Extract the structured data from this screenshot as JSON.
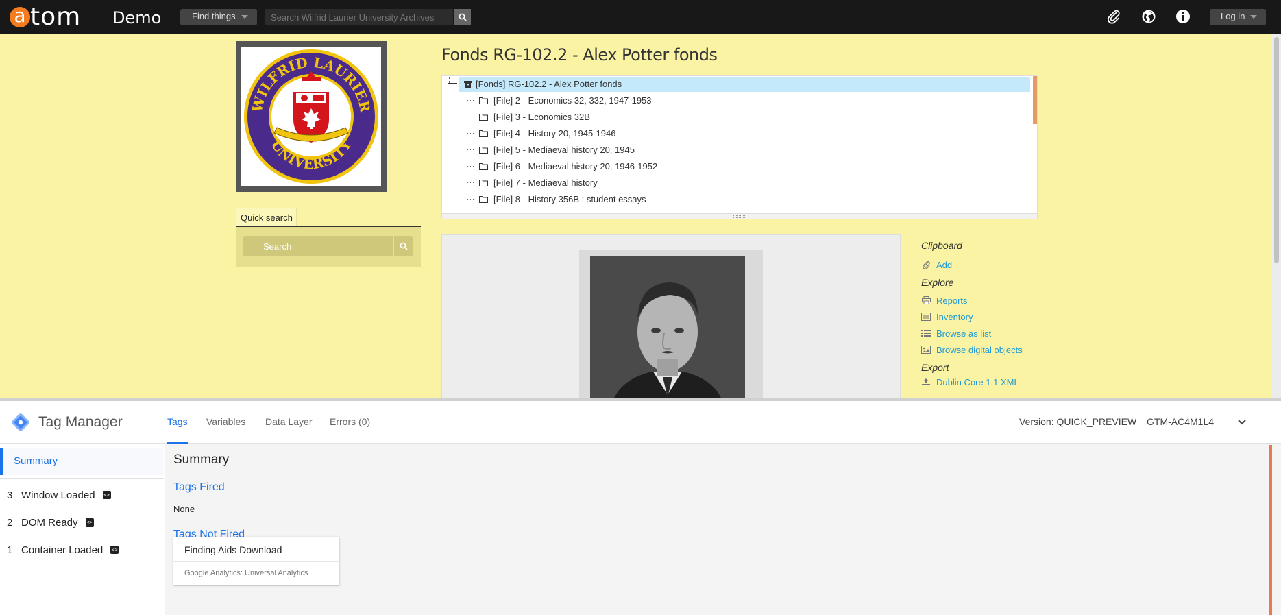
{
  "header": {
    "logo_letter": "a",
    "logo_text": "tom",
    "site_name": "Demo",
    "find_things": "Find things",
    "search_placeholder": "Search Wilfrid Laurier University Archives",
    "login": "Log in",
    "icons": [
      "search-icon",
      "paperclip-icon",
      "globe-icon",
      "info-icon"
    ]
  },
  "sidebar": {
    "quick_search_tab": "Quick search",
    "quick_search_placeholder": "Search"
  },
  "main": {
    "title": "Fonds RG-102.2 - Alex Potter fonds",
    "tree": {
      "root": "[Fonds] RG-102.2 - Alex Potter fonds",
      "items": [
        "[File] 2 - Economics 32, 332, 1947-1953",
        "[File] 3 - Economics 32B",
        "[File] 4 - History 20, 1945-1946",
        "[File] 5 - Mediaeval history 20, 1945",
        "[File] 6 - Mediaeval history 20, 1946-1952",
        "[File] 7 - Mediaeval history",
        "[File] 8 - History 356B : student essays"
      ]
    }
  },
  "right_menu": {
    "clipboard_heading": "Clipboard",
    "add": "Add",
    "explore_heading": "Explore",
    "reports": "Reports",
    "inventory": "Inventory",
    "browse_list": "Browse as list",
    "browse_digital": "Browse digital objects",
    "export_heading": "Export",
    "dublin_core": "Dublin Core 1.1 XML"
  },
  "tag_manager": {
    "title": "Tag Manager",
    "tabs": [
      "Tags",
      "Variables",
      "Data Layer",
      "Errors (0)"
    ],
    "version": "Version: QUICK_PREVIEW",
    "container_id": "GTM-AC4M1L4",
    "left": {
      "summary": "Summary",
      "events": [
        {
          "num": "3",
          "label": "Window Loaded"
        },
        {
          "num": "2",
          "label": "DOM Ready"
        },
        {
          "num": "1",
          "label": "Container Loaded"
        }
      ]
    },
    "main": {
      "heading": "Summary",
      "tags_fired": "Tags Fired",
      "tags_fired_value": "None",
      "tags_not_fired": "Tags Not Fired",
      "card_title": "Finding Aids Download",
      "card_sub": "Google Analytics: Universal Analytics"
    }
  },
  "colors": {
    "page_bg": "#f9f3a3",
    "topbar": "#181818",
    "accent_orange": "#f47c20",
    "link_blue": "#1f9ad6",
    "tm_blue": "#1a73e8",
    "tree_selected": "#c3e9fb"
  }
}
